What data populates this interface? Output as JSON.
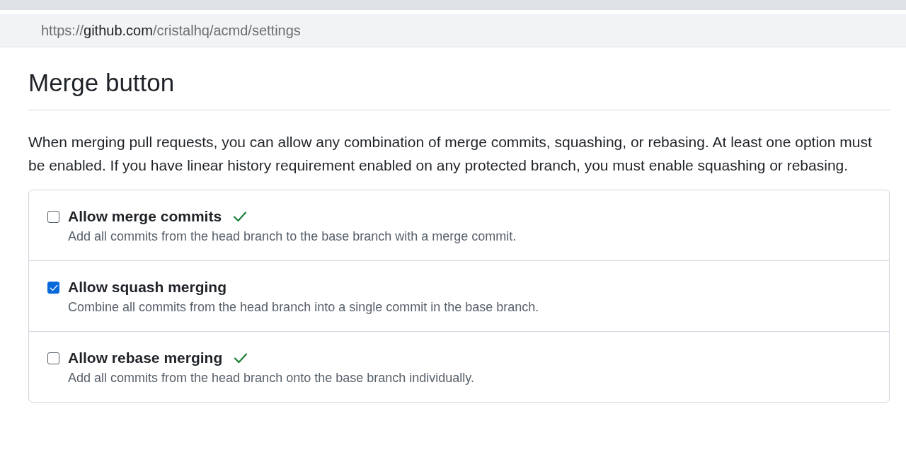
{
  "address_bar": {
    "scheme": "https://",
    "domain": "github.com",
    "path": "/cristalhq/acmd/settings"
  },
  "section": {
    "title": "Merge button",
    "description": "When merging pull requests, you can allow any combination of merge commits, squashing, or rebasing. At least one option must be enabled. If you have linear history requirement enabled on any protected branch, you must enable squashing or rebasing."
  },
  "options": [
    {
      "label": "Allow merge commits",
      "description": "Add all commits from the head branch to the base branch with a merge commit.",
      "checked": false,
      "check_mark": true
    },
    {
      "label": "Allow squash merging",
      "description": "Combine all commits from the head branch into a single commit in the base branch.",
      "checked": true,
      "check_mark": false
    },
    {
      "label": "Allow rebase merging",
      "description": "Add all commits from the head branch onto the base branch individually.",
      "checked": false,
      "check_mark": true
    }
  ]
}
